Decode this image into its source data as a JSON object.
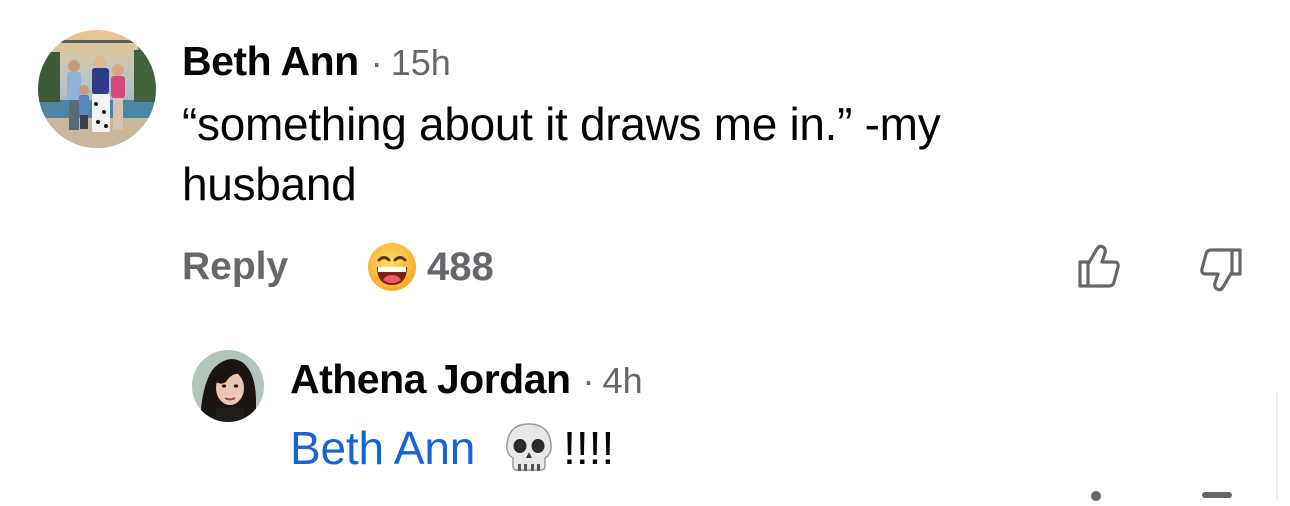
{
  "comment": {
    "author": "Beth Ann",
    "separator": "·",
    "time": "15h",
    "text": "“something about it draws me in.” -my husband",
    "actions": {
      "reply_label": "Reply",
      "reaction_icon": "grinning-face-emoji",
      "reaction_count": "488",
      "like_icon": "thumbs-up-icon",
      "dislike_icon": "thumbs-down-icon"
    }
  },
  "reply": {
    "author": "Athena Jordan",
    "separator": "·",
    "time": "4h",
    "mention": "Beth Ann",
    "emoji": "skull-emoji",
    "trailing_text": "!!!!"
  },
  "colors": {
    "text": "#050505",
    "secondary": "#65676b",
    "mention": "#1a64d2"
  }
}
